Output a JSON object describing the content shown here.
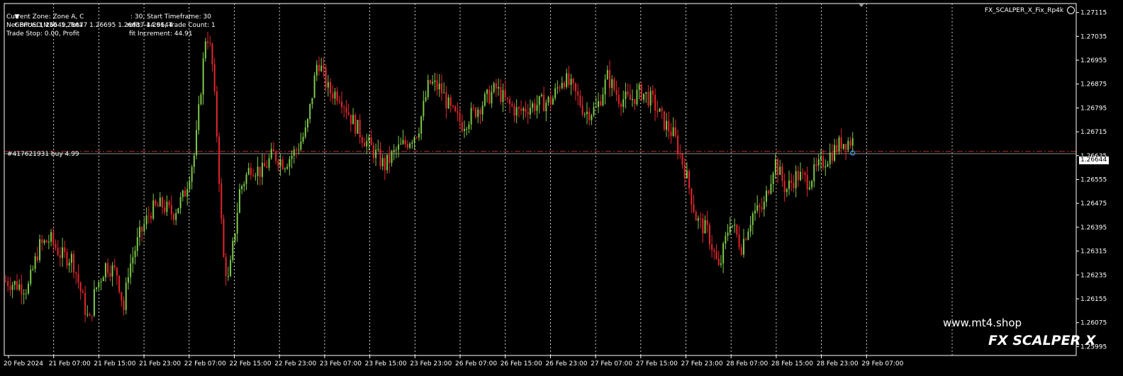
{
  "symbol_header": {
    "arrow": "▼",
    "text": "GBPUSD,M30  1.26677 1.26695 1.26637 1.26644"
  },
  "info_panel": [
    "Current Zone: Zone A, C",
    "Net Price: 1.26649, Tota",
    "Trade Stop: 0.00, Profit"
  ],
  "info_panel_right": [
    ": 30, Start Timeframe: 30",
    "rofit: -44.91, Trade Count: 1",
    "fit Increment: 44.91"
  ],
  "indicator_name": "FX_SCALPER_X_Fix_Rp4k",
  "order_label": "#417621931 buy 4.99",
  "current_price": "1.26644",
  "watermark_url": "www.mt4.shop",
  "watermark_title": "FX SCALPER X",
  "colors": {
    "bull": "#7dc84b",
    "bear": "#e4262c",
    "grid": "#ffffff",
    "order_line": "#c0302d",
    "background": "#000000"
  },
  "price_axis": {
    "labels": [
      "1.27115",
      "1.27035",
      "1.26955",
      "1.26875",
      "1.26795",
      "1.26715",
      "1.26635",
      "1.26555",
      "1.26475",
      "1.26395",
      "1.26315",
      "1.26235",
      "1.26155",
      "1.26075",
      "1.25995"
    ],
    "max": 1.27145,
    "min": 1.25965
  },
  "time_axis": {
    "labels": [
      "20 Feb 2024",
      "21 Feb 07:00",
      "21 Feb 15:00",
      "21 Feb 23:00",
      "22 Feb 07:00",
      "22 Feb 15:00",
      "22 Feb 23:00",
      "23 Feb 07:00",
      "23 Feb 15:00",
      "23 Feb 23:00",
      "26 Feb 07:00",
      "26 Feb 15:00",
      "26 Feb 23:00",
      "27 Feb 07:00",
      "27 Feb 15:00",
      "27 Feb 23:00",
      "28 Feb 07:00",
      "28 Feb 15:00",
      "28 Feb 23:00",
      "29 Feb 07:00"
    ]
  },
  "chart_data": {
    "type": "candlestick",
    "symbol": "GBPUSD",
    "timeframe": "M30",
    "last_bar": {
      "open": 1.26677,
      "high": 1.26695,
      "low": 1.26637,
      "close": 1.26644
    },
    "order_price": 1.26649,
    "close_path": [
      [
        0,
        1.26215
      ],
      [
        2,
        1.2619
      ],
      [
        3,
        1.2633
      ],
      [
        4,
        1.26355
      ],
      [
        5,
        1.263
      ],
      [
        6,
        1.2629
      ],
      [
        7,
        1.2614
      ],
      [
        7.5,
        1.2607
      ],
      [
        8,
        1.2618
      ],
      [
        9,
        1.2627
      ],
      [
        10,
        1.2624
      ],
      [
        10.6,
        1.2612
      ],
      [
        11,
        1.2625
      ],
      [
        12,
        1.26365
      ],
      [
        13,
        1.2645
      ],
      [
        14,
        1.2647
      ],
      [
        15,
        1.2644
      ],
      [
        16,
        1.265
      ],
      [
        17,
        1.2665
      ],
      [
        18,
        1.2706
      ],
      [
        18.5,
        1.2696
      ],
      [
        19,
        1.2668
      ],
      [
        19.5,
        1.263
      ],
      [
        20,
        1.2621
      ],
      [
        21,
        1.2652
      ],
      [
        22,
        1.266
      ],
      [
        23,
        1.2658
      ],
      [
        24,
        1.2664
      ],
      [
        25,
        1.2661
      ],
      [
        26,
        1.2665
      ],
      [
        27,
        1.2672
      ],
      [
        28,
        1.2696
      ],
      [
        29,
        1.2685
      ],
      [
        30,
        1.2684
      ],
      [
        31,
        1.2676
      ],
      [
        32,
        1.267
      ],
      [
        33,
        1.2665
      ],
      [
        34,
        1.266
      ],
      [
        35,
        1.2665
      ],
      [
        36,
        1.2668
      ],
      [
        37,
        1.2672
      ],
      [
        38,
        1.2688
      ],
      [
        39,
        1.2686
      ],
      [
        40,
        1.2678
      ],
      [
        41,
        1.2674
      ],
      [
        42,
        1.2678
      ],
      [
        43,
        1.2682
      ],
      [
        44,
        1.2686
      ],
      [
        45,
        1.2681
      ],
      [
        46,
        1.2678
      ],
      [
        47,
        1.268
      ],
      [
        48,
        1.2681
      ],
      [
        49,
        1.2682
      ],
      [
        50,
        1.269
      ],
      [
        51,
        1.2685
      ],
      [
        52,
        1.2678
      ],
      [
        53,
        1.2679
      ],
      [
        54,
        1.269
      ],
      [
        55,
        1.2683
      ],
      [
        56,
        1.2682
      ],
      [
        57,
        1.2685
      ],
      [
        58,
        1.2682
      ],
      [
        59,
        1.2675
      ],
      [
        60,
        1.267
      ],
      [
        61,
        1.2658
      ],
      [
        62,
        1.2642
      ],
      [
        63,
        1.2638
      ],
      [
        64,
        1.2625
      ],
      [
        65,
        1.2642
      ],
      [
        66,
        1.2633
      ],
      [
        67,
        1.2644
      ],
      [
        68,
        1.2646
      ],
      [
        69,
        1.2662
      ],
      [
        70,
        1.2652
      ],
      [
        71,
        1.2657
      ],
      [
        72,
        1.2655
      ],
      [
        73,
        1.266
      ],
      [
        74,
        1.2664
      ],
      [
        75,
        1.2668
      ],
      [
        76,
        1.26685
      ]
    ]
  }
}
